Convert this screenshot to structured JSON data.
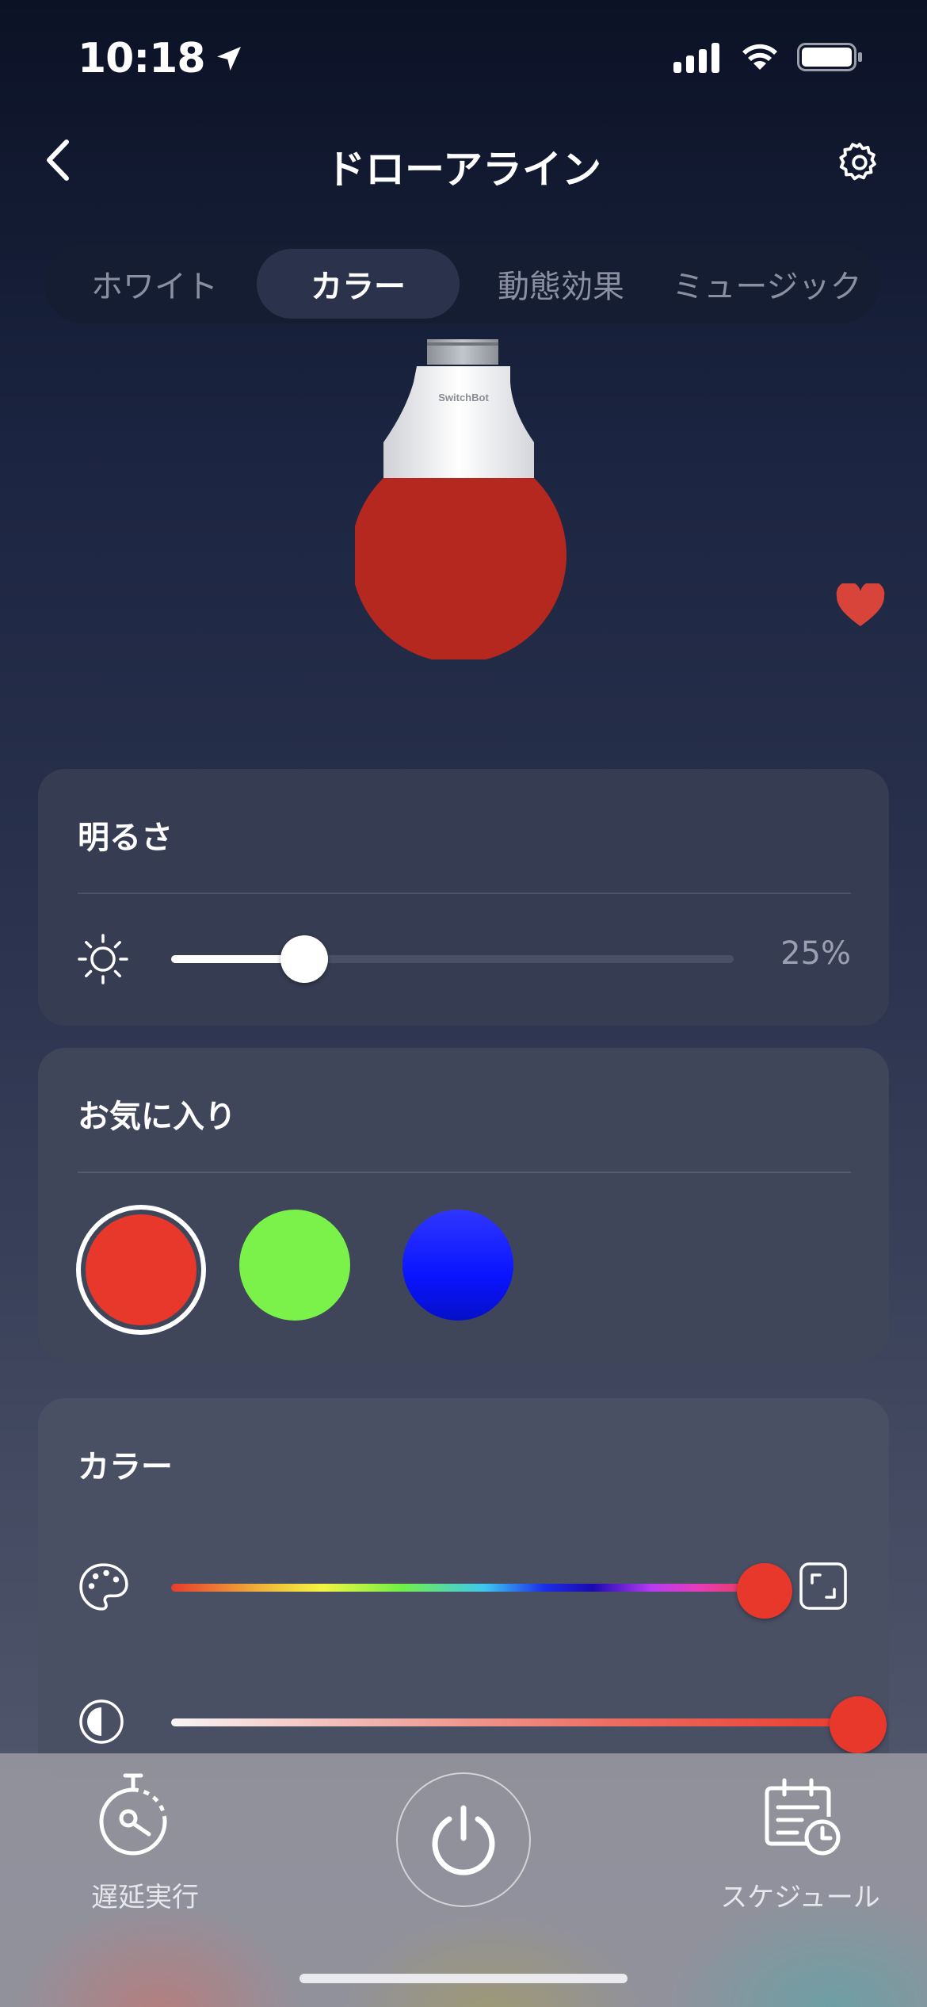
{
  "status_bar": {
    "time": "10:18"
  },
  "header": {
    "title": "ドローアライン"
  },
  "tabs": [
    {
      "label": "ホワイト",
      "active": false
    },
    {
      "label": "カラー",
      "active": true
    },
    {
      "label": "動態効果",
      "active": false
    },
    {
      "label": "ミュージック",
      "active": false
    }
  ],
  "bulb": {
    "brand_label": "SwitchBot",
    "color": "#b5281f"
  },
  "brightness": {
    "title": "明るさ",
    "value_label": "25%",
    "value_fraction": 0.25
  },
  "favorites": {
    "title": "お気に入り",
    "colors": [
      "#e8382c",
      "#7af24a",
      "#0a14ff"
    ],
    "selected_index": 0
  },
  "color_section": {
    "title": "カラー",
    "hue_fraction": 1.0,
    "saturation_fraction": 1.0,
    "current_color": "#e8382c"
  },
  "bottom_bar": {
    "delay_label": "遅延実行",
    "schedule_label": "スケジュール"
  },
  "icons": {
    "back": "chevron-left-icon",
    "settings": "gear-icon",
    "favorite": "heart-icon",
    "brightness": "sun-icon",
    "palette": "palette-icon",
    "expand": "expand-icon",
    "contrast": "contrast-icon",
    "delay": "stopwatch-icon",
    "power": "power-icon",
    "schedule": "calendar-clock-icon"
  }
}
